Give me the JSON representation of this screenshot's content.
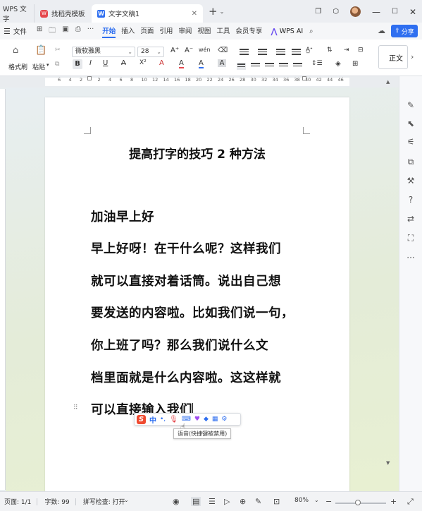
{
  "titlebar": {
    "app_label": "WPS 文字",
    "tab2_label": "找稻壳模板",
    "tab2_logo": "W",
    "active_tab_label": "文字文稿1",
    "active_tab_logo": "W",
    "close_glyph": "✕",
    "add_glyph": "+",
    "add_dropdown_glyph": "⌄"
  },
  "menubar": {
    "file_label": "文件",
    "tabs": [
      "开始",
      "插入",
      "页面",
      "引用",
      "审阅",
      "视图",
      "工具",
      "会员专享"
    ],
    "active_tab": "开始",
    "wps_ai_label": "WPS AI",
    "share_label": "分享"
  },
  "ribbon": {
    "format_painter_label": "格式刷",
    "paste_label": "粘贴",
    "font_name": "微软雅黑",
    "font_size": "28",
    "bold": "B",
    "italic": "I",
    "underline": "U",
    "strike": "A",
    "superscript": "X²",
    "style_label": "正文",
    "grow_font": "A⁺",
    "shrink_font": "A⁻",
    "phonetic": "wén",
    "font_color_letter": "A",
    "highlight_letter": "A",
    "char_shade_letter": "A",
    "accent_red": "#e5484d",
    "accent_blue": "#2f6ff0"
  },
  "ruler": {
    "numbers": [
      "6",
      "4",
      "2",
      "2",
      "4",
      "6",
      "8",
      "10",
      "12",
      "14",
      "16",
      "18",
      "20",
      "22",
      "24",
      "26",
      "28",
      "30",
      "32",
      "34",
      "36",
      "38",
      "40",
      "42",
      "44",
      "46"
    ]
  },
  "document": {
    "title": "提高打字的技巧 2 种方法",
    "lines": [
      "加油早上好",
      "早上好呀！在干什么呢？这样我们",
      "就可以直接对着话筒。说出自己想",
      "要发送的内容啦。比如我们说一句，",
      "你上班了吗？那么我们说什么文",
      "档里面就是什么内容啦。这这样就",
      "可以直接输入我们"
    ]
  },
  "ime": {
    "logo": "S",
    "mode": "中",
    "punct": "•,",
    "tooltip": "语音(快捷键被禁用)"
  },
  "statusbar": {
    "page_label": "页面: 1/1",
    "word_count": "字数: 99",
    "spellcheck": "拼写检查: 打开",
    "zoom": "80%"
  }
}
